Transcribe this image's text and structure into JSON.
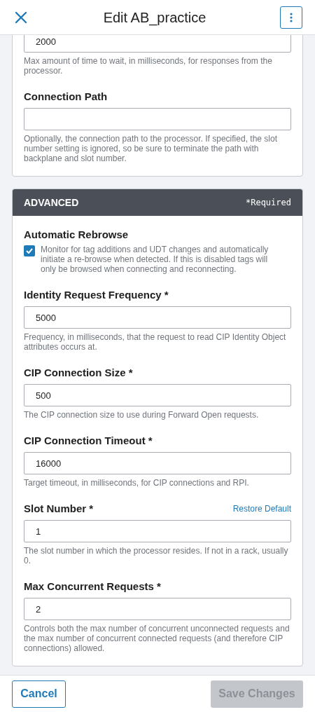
{
  "header": {
    "title": "Edit AB_practice"
  },
  "sections": [
    {
      "kind": "plain",
      "fields": [
        {
          "kind": "input",
          "value": "2000",
          "help": "Max amount of time to wait, in milliseconds, for responses from the processor."
        },
        {
          "kind": "input",
          "label": "Connection Path",
          "help": "Optionally, the connection path to the processor. If specified, the slot number setting is ignored, so be sure to terminate the path with backplane and slot number."
        }
      ]
    },
    {
      "kind": "titled",
      "title": "ADVANCED",
      "note": "*Required",
      "fields": [
        {
          "kind": "checkbox",
          "label": "Automatic Rebrowse",
          "checked": true,
          "help": "Monitor for tag additions and UDT changes and automatically initiate a re-browse when detected. If this is disabled tags will only be browsed when connecting and reconnecting."
        },
        {
          "kind": "input",
          "label": "Identity Request Frequency *",
          "value": "5000",
          "help": "Frequency, in milliseconds, that the request to read CIP Identity Object attributes occurs at."
        },
        {
          "kind": "input",
          "label": "CIP Connection Size *",
          "value": "500",
          "help": "The CIP connection size to use during Forward Open requests."
        },
        {
          "kind": "input",
          "label": "CIP Connection Timeout *",
          "value": "16000",
          "help": "Target timeout, in milliseconds, for CIP connections and RPI."
        },
        {
          "kind": "input",
          "label": "Slot Number *",
          "action": "Restore Default",
          "value": "1",
          "help": "The slot number in which the processor resides. If not in a rack, usually 0."
        },
        {
          "kind": "input",
          "label": "Max Concurrent Requests *",
          "value": "2",
          "help": "Controls both the max number of concurrent unconnected requests and the max number of concurrent connected requests (and therefore CIP connections) allowed."
        }
      ]
    }
  ],
  "footer": [
    {
      "label": "Cancel",
      "kind": "secondary",
      "disabled": false
    },
    {
      "label": "Save Changes",
      "kind": "primary",
      "disabled": true
    }
  ]
}
